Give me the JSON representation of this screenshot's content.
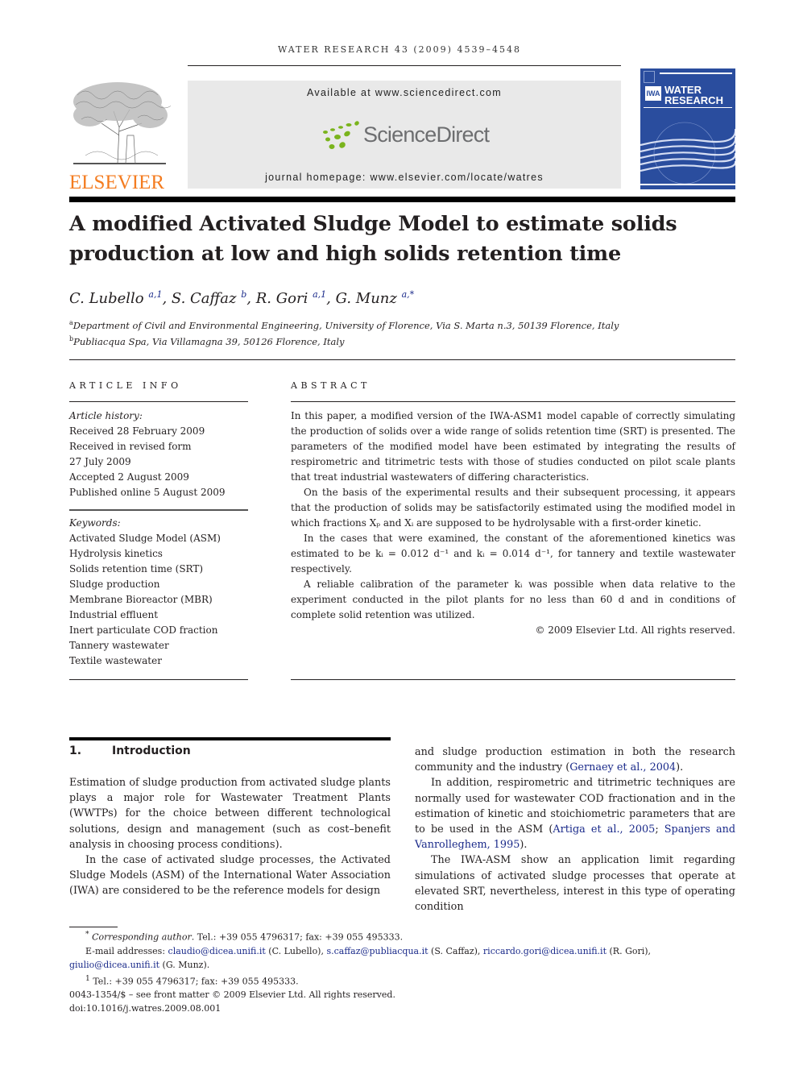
{
  "running_head": "WATER RESEARCH 43 (2009) 4539–4548",
  "masthead": {
    "publisher_logo_text": "ELSEVIER",
    "available_at": "Available at www.sciencedirect.com",
    "sciencedirect_wordmark": "ScienceDirect",
    "journal_homepage": "journal homepage: www.elsevier.com/locate/watres",
    "cover": {
      "iwa_badge": "IWA",
      "title_line1": "WATER",
      "title_line2": "RESEARCH"
    },
    "colors": {
      "elsevier_orange": "#f47c20",
      "sd_green": "#7ab41d",
      "cover_blue": "#2a4d9e",
      "link_blue": "#1a2a8a"
    }
  },
  "article": {
    "title": "A modified Activated Sludge Model to estimate solids production at low and high solids retention time",
    "authors": [
      {
        "name": "C. Lubello",
        "sup": "a,1",
        "sep": ", "
      },
      {
        "name": "S. Caffaz",
        "sup": "b",
        "sep": ", "
      },
      {
        "name": "R. Gori",
        "sup": "a,1",
        "sep": ", "
      },
      {
        "name": "G. Munz",
        "sup": "a,*",
        "sep": ""
      }
    ],
    "affiliations": [
      {
        "mark": "a",
        "text": "Department of Civil and Environmental Engineering, University of Florence, Via S. Marta n.3, 50139 Florence, Italy"
      },
      {
        "mark": "b",
        "text": "Publiacqua Spa, Via Villamagna 39, 50126 Florence, Italy"
      }
    ]
  },
  "article_info": {
    "heading": "ARTICLE INFO",
    "history_label": "Article history:",
    "history": [
      "Received 28 February 2009",
      "Received in revised form",
      "27 July 2009",
      "Accepted 2 August 2009",
      "Published online 5 August 2009"
    ],
    "keywords_label": "Keywords:",
    "keywords": [
      "Activated Sludge Model (ASM)",
      "Hydrolysis kinetics",
      "Solids retention time (SRT)",
      "Sludge production",
      "Membrane Bioreactor (MBR)",
      "Industrial effluent",
      "Inert particulate COD fraction",
      "Tannery wastewater",
      "Textile wastewater"
    ]
  },
  "abstract": {
    "heading": "ABSTRACT",
    "paragraphs": [
      "In this paper, a modified version of the IWA-ASM1 model capable of correctly simulating the production of solids over a wide range of solids retention time (SRT) is presented. The parameters of the modified model have been estimated by integrating the results of respirometric and titrimetric tests with those of studies conducted on pilot scale plants that treat industrial wastewaters of differing characteristics.",
      "On the basis of the experimental results and their subsequent processing, it appears that the production of solids may be satisfactorily estimated using the modified model in which fractions Xₚ and Xᵢ are supposed to be hydrolysable with a first-order kinetic.",
      "In the cases that were examined, the constant of the aforementioned kinetics was estimated to be kᵢ = 0.012 d⁻¹ and kᵢ = 0.014 d⁻¹, for tannery and textile wastewater respectively.",
      "A reliable calibration of the parameter kᵢ was possible when data relative to the experiment conducted in the pilot plants for no less than 60 d and in conditions of complete solid retention was utilized."
    ],
    "copyright": "© 2009 Elsevier Ltd. All rights reserved."
  },
  "introduction": {
    "number": "1.",
    "heading": "Introduction",
    "left": [
      {
        "text": "Estimation of sludge production from activated sludge plants plays a major role for Wastewater Treatment Plants (WWTPs) for the choice between different technological solutions, design and management (such as cost–benefit analysis in choosing process conditions)."
      },
      {
        "text": "In the case of activated sludge processes, the Activated Sludge Models (ASM) of the International Water Association (IWA) are considered to be the reference models for design"
      }
    ],
    "right": {
      "p1_text": "and sludge production estimation in both the research community and the industry (",
      "p1_cite": "Gernaey et al., 2004",
      "p1_end": ").",
      "p2_text": "In addition, respirometric and titrimetric techniques are normally used for wastewater COD fractionation and in the estimation of kinetic and stoichiometric parameters that are to be used in the ASM (",
      "p2_cite1": "Artiga et al., 2005",
      "p2_sep": "; ",
      "p2_cite2": "Spanjers and Vanrolleghem, 1995",
      "p2_end": ").",
      "p3_text": "The IWA-ASM show an application limit regarding simulations of activated sludge processes that operate at elevated SRT, nevertheless, interest in this type of operating condition"
    }
  },
  "footnotes": {
    "corr_mark": "*",
    "corr_label": "Corresponding author",
    "corr_text": ". Tel.: +39 055 4796317; fax: +39 055 495333.",
    "email_label": "E-mail addresses: ",
    "emails": [
      {
        "email": "claudio@dicea.unifi.it",
        "who": " (C. Lubello), "
      },
      {
        "email": "s.caffaz@publiacqua.it",
        "who": " (S. Caffaz), "
      },
      {
        "email": "riccardo.gori@dicea.unifi.it",
        "who": " (R. Gori), "
      },
      {
        "email": "giulio@dicea.unifi.it",
        "who": " (G. Munz)."
      }
    ],
    "note1_mark": "1",
    "note1_text": " Tel.: +39 055 4796317; fax: +39 055 495333.",
    "issn_line": "0043-1354/$ – see front matter © 2009 Elsevier Ltd. All rights reserved.",
    "doi": "doi:10.1016/j.watres.2009.08.001"
  }
}
